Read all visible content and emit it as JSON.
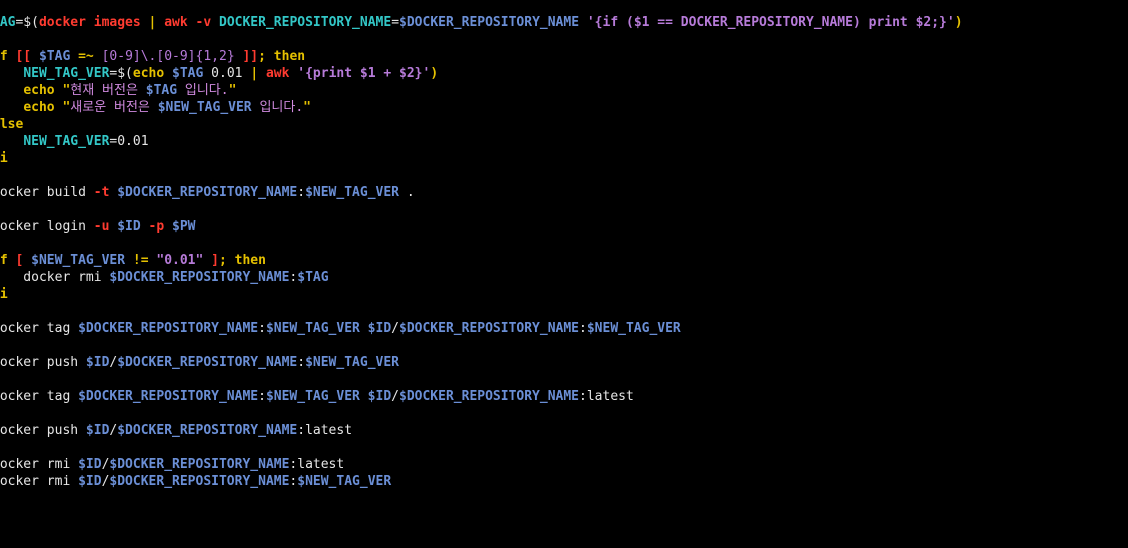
{
  "colors": {
    "background": "#000000",
    "plain": "#e6e6e6",
    "variable": "#6b8fd6",
    "variable_bold": "#5f87d7",
    "keyword": "#e5c100",
    "command_red": "#ff3b30",
    "string": "#e5c100",
    "string_inner": "#d08adf",
    "teal": "#33c7c7",
    "purple": "#b77bd9",
    "tilde": "#3d6fc1"
  },
  "editor": {
    "lines": [
      {
        "tokens": [
          {
            "text": "TAG",
            "color": "#33c7c7",
            "bold": true
          },
          {
            "text": "=$(",
            "color": "#e6e6e6"
          },
          {
            "text": "docker images",
            "color": "#ff3b30",
            "bold": true
          },
          {
            "text": " | ",
            "color": "#e5c100",
            "bold": true
          },
          {
            "text": "awk",
            "color": "#ff3b30",
            "bold": true
          },
          {
            "text": " -v ",
            "color": "#ff3b30",
            "bold": true
          },
          {
            "text": "DOCKER_REPOSITORY_NAME",
            "color": "#33c7c7",
            "bold": true
          },
          {
            "text": "=",
            "color": "#e6e6e6"
          },
          {
            "text": "$DOCKER_REPOSITORY_NAME",
            "color": "#6b8fd6",
            "bold": true
          },
          {
            "text": " '{if ($1 == DOCKER_REPOSITORY_NAME) print $2;}'",
            "color": "#b77bd9",
            "bold": true
          },
          {
            "text": ")",
            "color": "#e5c100",
            "bold": true
          }
        ]
      },
      {
        "tokens": []
      },
      {
        "tokens": [
          {
            "text": "if",
            "color": "#e5c100",
            "bold": true
          },
          {
            "text": " [[ ",
            "color": "#ff3b30",
            "bold": true
          },
          {
            "text": "$TAG",
            "color": "#6b8fd6",
            "bold": true
          },
          {
            "text": " =~ ",
            "color": "#e5c100",
            "bold": true
          },
          {
            "text": "[0-9]\\.[0-9]{1,2}",
            "color": "#b77bd9"
          },
          {
            "text": " ]]",
            "color": "#ff3b30",
            "bold": true
          },
          {
            "text": "; ",
            "color": "#e5c100",
            "bold": true
          },
          {
            "text": "then",
            "color": "#e5c100",
            "bold": true
          }
        ]
      },
      {
        "tokens": [
          {
            "text": "    ",
            "color": "#e6e6e6"
          },
          {
            "text": "NEW_TAG_VER",
            "color": "#33c7c7",
            "bold": true
          },
          {
            "text": "=$(",
            "color": "#e6e6e6"
          },
          {
            "text": "echo",
            "color": "#e5c100",
            "bold": true
          },
          {
            "text": " $TAG",
            "color": "#6b8fd6",
            "bold": true
          },
          {
            "text": " 0.01 ",
            "color": "#e6e6e6"
          },
          {
            "text": "| ",
            "color": "#e5c100",
            "bold": true
          },
          {
            "text": "awk",
            "color": "#ff3b30",
            "bold": true
          },
          {
            "text": " '{print $1 + $2}'",
            "color": "#b77bd9",
            "bold": true
          },
          {
            "text": ")",
            "color": "#e5c100",
            "bold": true
          }
        ]
      },
      {
        "tokens": [
          {
            "text": "    ",
            "color": "#e6e6e6"
          },
          {
            "text": "echo",
            "color": "#e5c100",
            "bold": true
          },
          {
            "text": " \"",
            "color": "#e5c100",
            "bold": true
          },
          {
            "text": "현재 버전은 ",
            "color": "#d08adf"
          },
          {
            "text": "$TAG",
            "color": "#6b8fd6",
            "bold": true
          },
          {
            "text": " 입니다.",
            "color": "#d08adf"
          },
          {
            "text": "\"",
            "color": "#e5c100",
            "bold": true
          }
        ]
      },
      {
        "tokens": [
          {
            "text": "    ",
            "color": "#e6e6e6"
          },
          {
            "text": "echo",
            "color": "#e5c100",
            "bold": true
          },
          {
            "text": " \"",
            "color": "#e5c100",
            "bold": true
          },
          {
            "text": "새로운 버전은 ",
            "color": "#d08adf"
          },
          {
            "text": "$NEW_TAG_VER",
            "color": "#6b8fd6",
            "bold": true
          },
          {
            "text": " 입니다.",
            "color": "#d08adf"
          },
          {
            "text": "\"",
            "color": "#e5c100",
            "bold": true
          }
        ]
      },
      {
        "tokens": [
          {
            "text": "else",
            "color": "#e5c100",
            "bold": true
          }
        ]
      },
      {
        "tokens": [
          {
            "text": "    ",
            "color": "#e6e6e6"
          },
          {
            "text": "NEW_TAG_VER",
            "color": "#33c7c7",
            "bold": true
          },
          {
            "text": "=0.01",
            "color": "#e6e6e6"
          }
        ]
      },
      {
        "tokens": [
          {
            "text": "fi",
            "color": "#e5c100",
            "bold": true
          }
        ]
      },
      {
        "tokens": []
      },
      {
        "tokens": [
          {
            "text": "docker build ",
            "color": "#e6e6e6"
          },
          {
            "text": "-t",
            "color": "#ff3b30",
            "bold": true
          },
          {
            "text": " $DOCKER_REPOSITORY_NAME",
            "color": "#6b8fd6",
            "bold": true
          },
          {
            "text": ":",
            "color": "#e6e6e6"
          },
          {
            "text": "$NEW_TAG_VER",
            "color": "#6b8fd6",
            "bold": true
          },
          {
            "text": " .",
            "color": "#e6e6e6"
          }
        ]
      },
      {
        "tokens": []
      },
      {
        "tokens": [
          {
            "text": "docker login ",
            "color": "#e6e6e6"
          },
          {
            "text": "-u",
            "color": "#ff3b30",
            "bold": true
          },
          {
            "text": " $ID",
            "color": "#6b8fd6",
            "bold": true
          },
          {
            "text": " -p",
            "color": "#ff3b30",
            "bold": true
          },
          {
            "text": " $PW",
            "color": "#6b8fd6",
            "bold": true
          }
        ]
      },
      {
        "tokens": []
      },
      {
        "tokens": [
          {
            "text": "if",
            "color": "#e5c100",
            "bold": true
          },
          {
            "text": " [ ",
            "color": "#ff3b30",
            "bold": true
          },
          {
            "text": "$NEW_TAG_VER",
            "color": "#6b8fd6",
            "bold": true
          },
          {
            "text": " != ",
            "color": "#e5c100",
            "bold": true
          },
          {
            "text": "\"0.01\"",
            "color": "#b77bd9",
            "bold": true
          },
          {
            "text": " ]",
            "color": "#ff3b30",
            "bold": true
          },
          {
            "text": "; then",
            "color": "#e5c100",
            "bold": true
          }
        ]
      },
      {
        "tokens": [
          {
            "text": "    docker rmi ",
            "color": "#e6e6e6"
          },
          {
            "text": "$DOCKER_REPOSITORY_NAME",
            "color": "#6b8fd6",
            "bold": true
          },
          {
            "text": ":",
            "color": "#e6e6e6"
          },
          {
            "text": "$TAG",
            "color": "#6b8fd6",
            "bold": true
          }
        ]
      },
      {
        "tokens": [
          {
            "text": "fi",
            "color": "#e5c100",
            "bold": true
          }
        ]
      },
      {
        "tokens": []
      },
      {
        "tokens": [
          {
            "text": "docker tag ",
            "color": "#e6e6e6"
          },
          {
            "text": "$DOCKER_REPOSITORY_NAME",
            "color": "#6b8fd6",
            "bold": true
          },
          {
            "text": ":",
            "color": "#e6e6e6"
          },
          {
            "text": "$NEW_TAG_VER",
            "color": "#6b8fd6",
            "bold": true
          },
          {
            "text": " $ID",
            "color": "#6b8fd6",
            "bold": true
          },
          {
            "text": "/",
            "color": "#e6e6e6"
          },
          {
            "text": "$DOCKER_REPOSITORY_NAME",
            "color": "#6b8fd6",
            "bold": true
          },
          {
            "text": ":",
            "color": "#e6e6e6"
          },
          {
            "text": "$NEW_TAG_VER",
            "color": "#6b8fd6",
            "bold": true
          }
        ]
      },
      {
        "tokens": []
      },
      {
        "tokens": [
          {
            "text": "docker push ",
            "color": "#e6e6e6"
          },
          {
            "text": "$ID",
            "color": "#6b8fd6",
            "bold": true
          },
          {
            "text": "/",
            "color": "#e6e6e6"
          },
          {
            "text": "$DOCKER_REPOSITORY_NAME",
            "color": "#6b8fd6",
            "bold": true
          },
          {
            "text": ":",
            "color": "#e6e6e6"
          },
          {
            "text": "$NEW_TAG_VER",
            "color": "#6b8fd6",
            "bold": true
          }
        ]
      },
      {
        "tokens": []
      },
      {
        "tokens": [
          {
            "text": "docker tag ",
            "color": "#e6e6e6"
          },
          {
            "text": "$DOCKER_REPOSITORY_NAME",
            "color": "#6b8fd6",
            "bold": true
          },
          {
            "text": ":",
            "color": "#e6e6e6"
          },
          {
            "text": "$NEW_TAG_VER",
            "color": "#6b8fd6",
            "bold": true
          },
          {
            "text": " $ID",
            "color": "#6b8fd6",
            "bold": true
          },
          {
            "text": "/",
            "color": "#e6e6e6"
          },
          {
            "text": "$DOCKER_REPOSITORY_NAME",
            "color": "#6b8fd6",
            "bold": true
          },
          {
            "text": ":latest",
            "color": "#e6e6e6"
          }
        ]
      },
      {
        "tokens": []
      },
      {
        "tokens": [
          {
            "text": "docker push ",
            "color": "#e6e6e6"
          },
          {
            "text": "$ID",
            "color": "#6b8fd6",
            "bold": true
          },
          {
            "text": "/",
            "color": "#e6e6e6"
          },
          {
            "text": "$DOCKER_REPOSITORY_NAME",
            "color": "#6b8fd6",
            "bold": true
          },
          {
            "text": ":latest",
            "color": "#e6e6e6"
          }
        ]
      },
      {
        "tokens": []
      },
      {
        "tokens": [
          {
            "text": "docker rmi ",
            "color": "#e6e6e6"
          },
          {
            "text": "$ID",
            "color": "#6b8fd6",
            "bold": true
          },
          {
            "text": "/",
            "color": "#e6e6e6"
          },
          {
            "text": "$DOCKER_REPOSITORY_NAME",
            "color": "#6b8fd6",
            "bold": true
          },
          {
            "text": ":latest",
            "color": "#e6e6e6"
          }
        ]
      },
      {
        "tokens": [
          {
            "text": "docker rmi ",
            "color": "#e6e6e6"
          },
          {
            "text": "$ID",
            "color": "#6b8fd6",
            "bold": true
          },
          {
            "text": "/",
            "color": "#e6e6e6"
          },
          {
            "text": "$DOCKER_REPOSITORY_NAME",
            "color": "#6b8fd6",
            "bold": true
          },
          {
            "text": ":",
            "color": "#e6e6e6"
          },
          {
            "text": "$NEW_TAG_VER",
            "color": "#6b8fd6",
            "bold": true
          }
        ]
      },
      {
        "tokens": [
          {
            "text": "~",
            "color": "#3d6fc1",
            "bold": true
          }
        ]
      },
      {
        "tokens": [
          {
            "text": "~",
            "color": "#3d6fc1",
            "bold": true
          }
        ]
      },
      {
        "tokens": [
          {
            "text": "~",
            "color": "#3d6fc1",
            "bold": true
          }
        ]
      }
    ]
  }
}
